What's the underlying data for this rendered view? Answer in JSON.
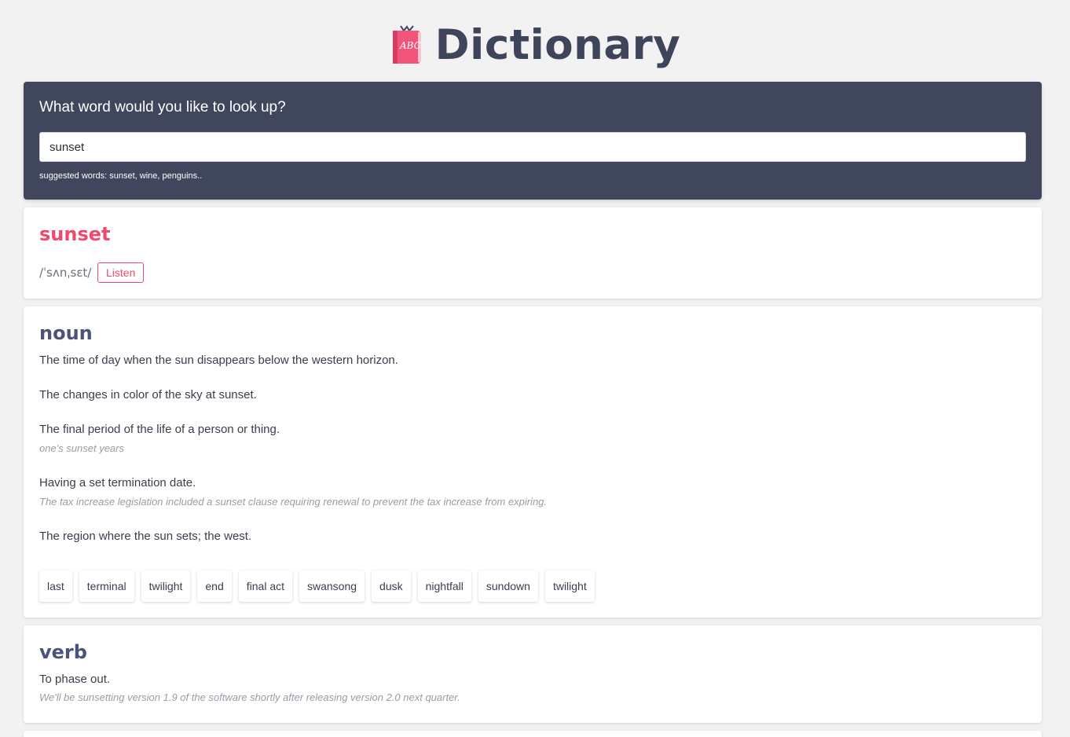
{
  "header": {
    "title": "Dictionary",
    "logo_icon": "book-abc-icon",
    "logo_text": "ABC"
  },
  "search": {
    "question": "What word would you like to look up?",
    "value": "sunset",
    "suggestions": "suggested words: sunset, wine, penguins.."
  },
  "word": {
    "title": "sunset",
    "phonetic": "/ˈsʌnˌsɛt/",
    "listen_label": "Listen"
  },
  "noun": {
    "pos": "noun",
    "definitions": [
      {
        "text": "The time of day when the sun disappears below the western horizon."
      },
      {
        "text": "The changes in color of the sky at sunset."
      },
      {
        "text": "The final period of the life of a person or thing.",
        "example": "one's sunset years"
      },
      {
        "text": "Having a set termination date.",
        "example": "The tax increase legislation included a sunset clause requiring renewal to prevent the tax increase from expiring."
      },
      {
        "text": "The region where the sun sets; the west."
      }
    ],
    "synonyms": [
      "last",
      "terminal",
      "twilight",
      "end",
      "final act",
      "swansong",
      "dusk",
      "nightfall",
      "sundown",
      "twilight"
    ]
  },
  "verb": {
    "pos": "verb",
    "definitions": [
      {
        "text": "To phase out.",
        "example": "We'll be sunsetting version 1.9 of the software shortly after releasing version 2.0 next quarter."
      }
    ]
  },
  "colors": {
    "background": "#f2f2f3",
    "search_panel": "#40465b",
    "accent": "#ef4a6b",
    "pos_heading": "#4d527a"
  }
}
